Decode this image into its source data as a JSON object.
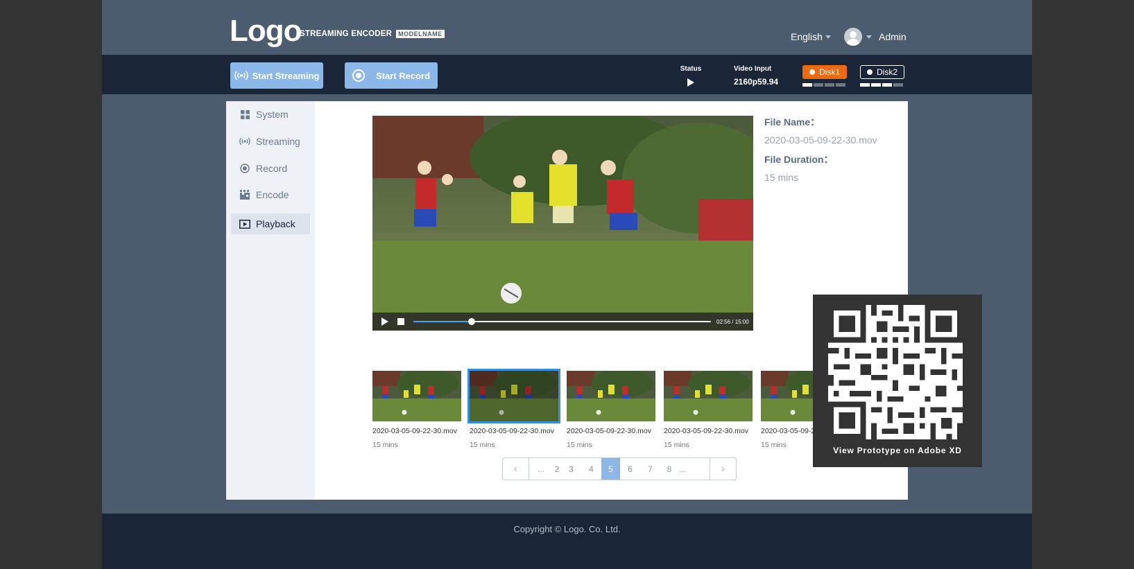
{
  "header": {
    "logo": "Logo",
    "product": "STREAMING ENCODER",
    "model": "MODELNAME",
    "language": "English",
    "user": "Admin"
  },
  "toolbar": {
    "start_streaming": "Start Streaming",
    "start_record": "Start Record",
    "status_label": "Status",
    "video_input_label": "Video Input",
    "video_input_value": "2160p59.94",
    "disk1": {
      "label": "Disk1",
      "level": 0.25,
      "color": "#ee6a10"
    },
    "disk2": {
      "label": "Disk2",
      "level": 0.75
    }
  },
  "sidebar": {
    "items": [
      {
        "label": "System",
        "icon": "grid-icon"
      },
      {
        "label": "Streaming",
        "icon": "broadcast-icon"
      },
      {
        "label": "Record",
        "icon": "record-icon"
      },
      {
        "label": "Encode",
        "icon": "encode-icon"
      },
      {
        "label": "Playback",
        "icon": "playback-icon",
        "active": true
      }
    ]
  },
  "player": {
    "time": "02:56 / 15:00",
    "progress": 0.196
  },
  "file_info": {
    "name_label": "File Name：",
    "name_value": "2020-03-05-09-22-30.mov",
    "duration_label": "File Duration：",
    "duration_value": "15 mins"
  },
  "thumbnails": [
    {
      "filename": "2020-03-05-09-22-30.mov",
      "duration": "15 mins"
    },
    {
      "filename": "2020-03-05-09-22-30.mov",
      "duration": "15 mins",
      "selected": true
    },
    {
      "filename": "2020-03-05-09-22-30.mov",
      "duration": "15 mins"
    },
    {
      "filename": "2020-03-05-09-22-30.mov",
      "duration": "15 mins"
    },
    {
      "filename": "2020-03-05-09-22-30.mov",
      "duration": "15 mins"
    }
  ],
  "pagination": {
    "prev": "‹",
    "next": "›",
    "pages": [
      "...",
      "2",
      "3",
      "4",
      "5",
      "6",
      "7",
      "8",
      "..."
    ],
    "current": "5"
  },
  "footer": {
    "copyright": "Copyright © Logo. Co. Ltd."
  },
  "qr_overlay": {
    "caption": "View Prototype on Adobe XD"
  },
  "colors": {
    "accent": "#8bb8e8",
    "header": "#4a5c6e",
    "toolbar": "#1b2538",
    "progress": "#4aa3ee"
  }
}
